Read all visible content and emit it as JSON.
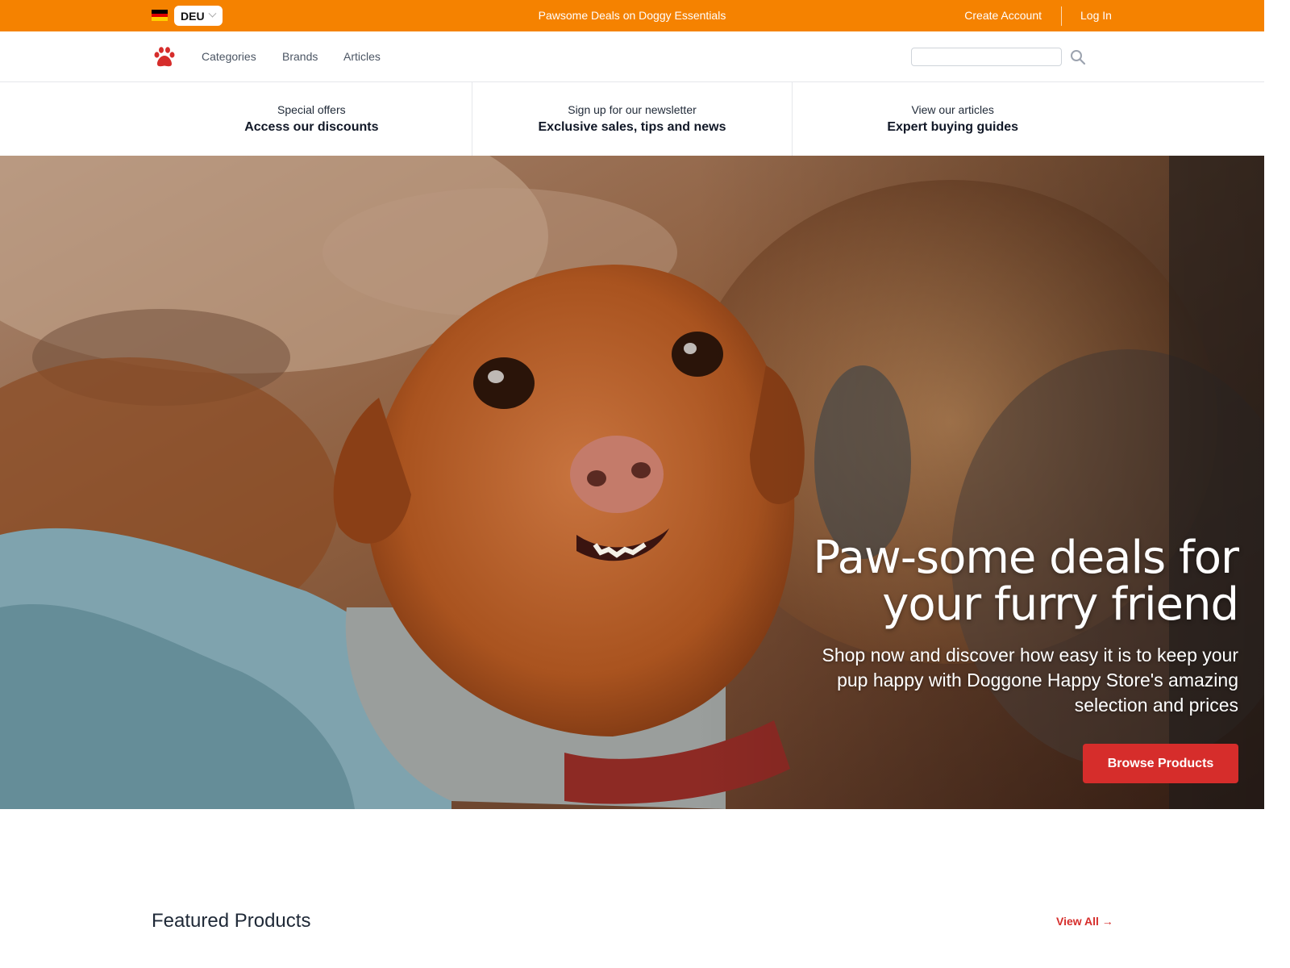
{
  "topbar": {
    "region_code": "DEU",
    "promo": "Pawsome Deals on Doggy Essentials",
    "create_account": "Create Account",
    "log_in": "Log In"
  },
  "nav": {
    "links": [
      "Categories",
      "Brands",
      "Articles"
    ],
    "search_placeholder": ""
  },
  "strip": [
    {
      "small": "Special offers",
      "big": "Access our discounts"
    },
    {
      "small": "Sign up for our newsletter",
      "big": "Exclusive sales, tips and news"
    },
    {
      "small": "View our articles",
      "big": "Expert buying guides"
    }
  ],
  "hero": {
    "title_line1": "Paw-some deals for",
    "title_line2": "your furry friend",
    "subtitle": "Shop now and discover how easy it is to keep your pup happy with Doggone Happy Store's amazing selection and prices",
    "button": "Browse Products"
  },
  "featured": {
    "title": "Featured Products",
    "view_all": "View All →"
  },
  "colors": {
    "topbar": "#f58200",
    "accent_red": "#d62d2b"
  },
  "icons": [
    "germany-flag-icon",
    "chevron-down-icon",
    "paw-logo-icon",
    "search-icon"
  ]
}
